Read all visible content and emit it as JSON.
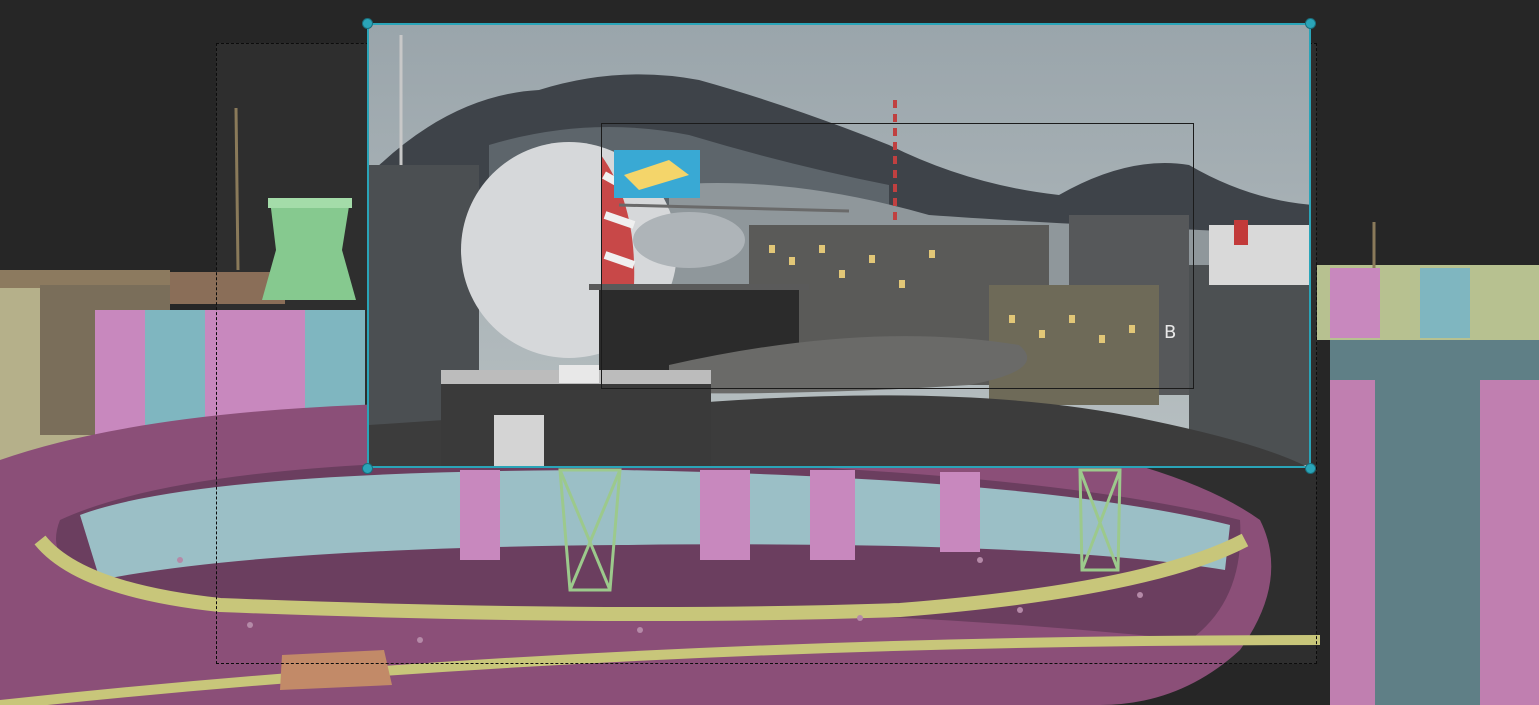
{
  "viewport": {
    "building_label": "B",
    "colors": {
      "background": "#262626",
      "render_region_border": "#2aa4b8",
      "camera_frame_border": "#0c0c0c",
      "deck_magenta": "#8b4f78",
      "wall_pink": "#c27fb6",
      "wall_cyan": "#7fb6c0",
      "trim_yellow": "#c8c67a",
      "tower_green": "#7fc58a"
    }
  }
}
